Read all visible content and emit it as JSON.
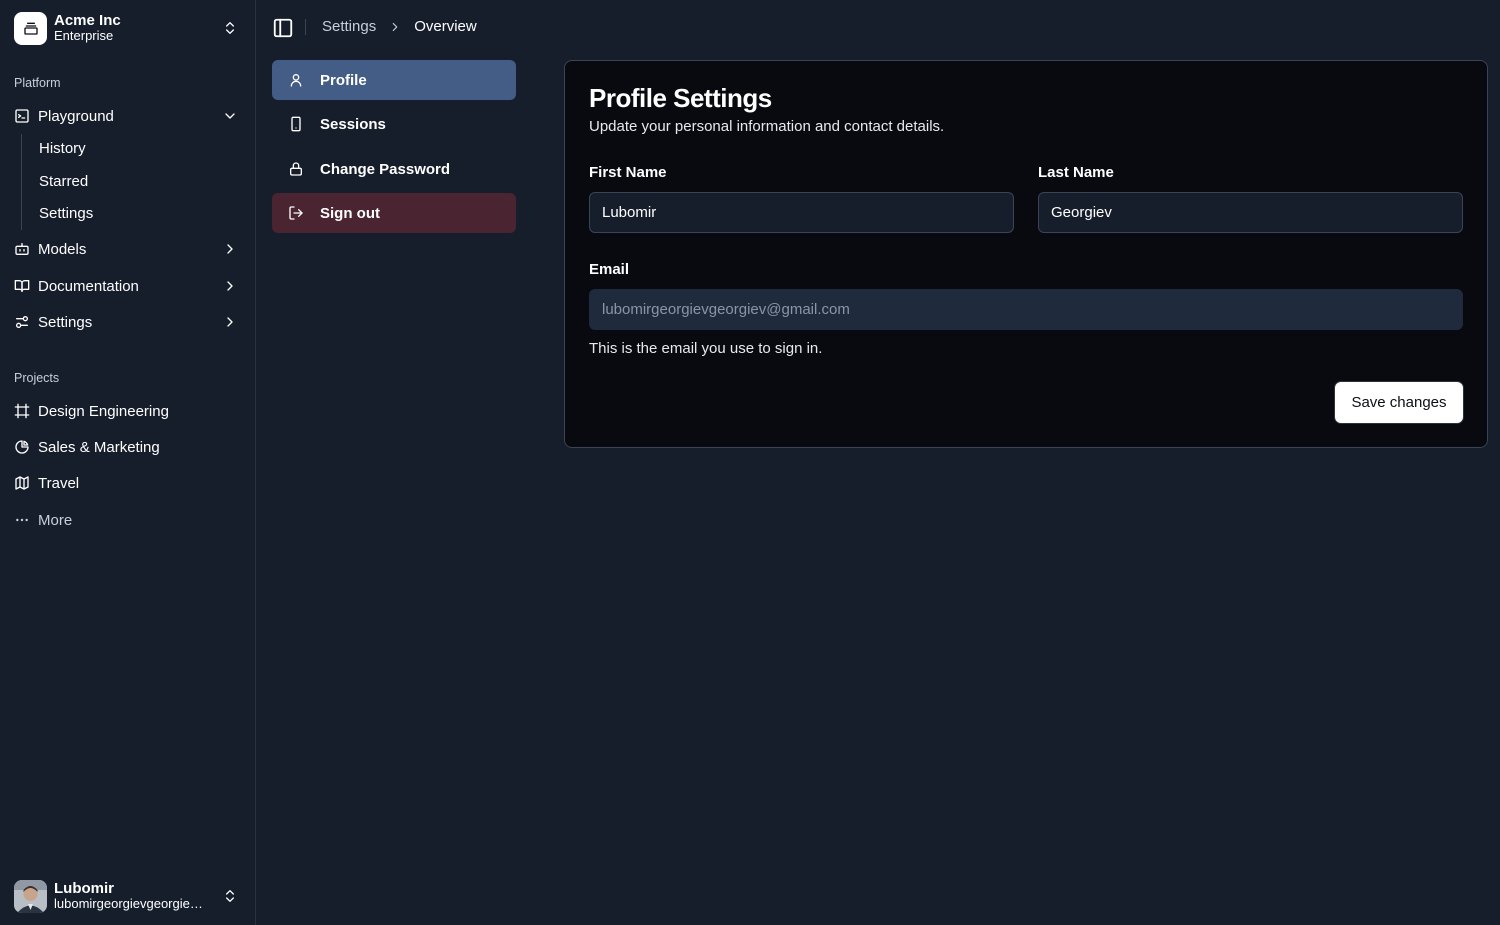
{
  "team": {
    "name": "Acme Inc",
    "plan": "Enterprise"
  },
  "sidebar": {
    "platform_label": "Platform",
    "platform_items": [
      {
        "label": "Playground",
        "icon": "terminal-square-icon",
        "expanded": true,
        "subitems": [
          {
            "label": "History"
          },
          {
            "label": "Starred"
          },
          {
            "label": "Settings"
          }
        ]
      },
      {
        "label": "Models",
        "icon": "bot-icon"
      },
      {
        "label": "Documentation",
        "icon": "book-open-icon"
      },
      {
        "label": "Settings",
        "icon": "settings-sliders-icon"
      }
    ],
    "projects_label": "Projects",
    "project_items": [
      {
        "label": "Design Engineering",
        "icon": "frame-icon"
      },
      {
        "label": "Sales & Marketing",
        "icon": "pie-chart-icon"
      },
      {
        "label": "Travel",
        "icon": "map-icon"
      },
      {
        "label": "More",
        "icon": "more-horizontal-icon"
      }
    ]
  },
  "user": {
    "name": "Lubomir",
    "email": "lubomirgeorgievgeorgiev@gmail.com"
  },
  "breadcrumb": {
    "parent": "Settings",
    "current": "Overview"
  },
  "settings_nav": [
    {
      "label": "Profile",
      "icon": "user-icon",
      "active": true
    },
    {
      "label": "Sessions",
      "icon": "smartphone-icon"
    },
    {
      "label": "Change Password",
      "icon": "lock-icon"
    },
    {
      "label": "Sign out",
      "icon": "log-out-icon",
      "danger": true
    }
  ],
  "profile": {
    "title": "Profile Settings",
    "description": "Update your personal information and contact details.",
    "first_name_label": "First Name",
    "first_name_value": "Lubomir",
    "last_name_label": "Last Name",
    "last_name_value": "Georgiev",
    "email_label": "Email",
    "email_value": "lubomirgeorgievgeorgiev@gmail.com",
    "email_hint": "This is the email you use to sign in.",
    "save_label": "Save changes"
  },
  "colors": {
    "background": "#161d2b",
    "card": "#080a0f",
    "active_nav": "#445d86",
    "danger_nav": "#4b2431"
  }
}
